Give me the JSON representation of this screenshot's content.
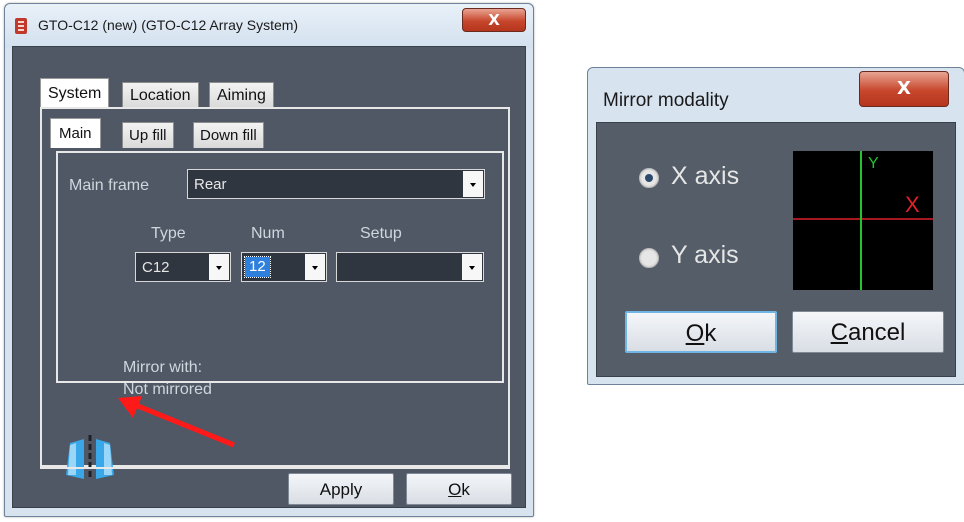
{
  "system_window": {
    "title": "GTO-C12 (new) (GTO-C12 Array System)",
    "close_glyph": "X",
    "tabs": [
      "System",
      "Location",
      "Aiming"
    ],
    "subtabs": [
      "Main",
      "Up fill",
      "Down fill"
    ],
    "main_frame": {
      "label": "Main frame",
      "value": "Rear"
    },
    "type": {
      "label": "Type",
      "value": "C12"
    },
    "num": {
      "label": "Num",
      "value": "12"
    },
    "setup": {
      "label": "Setup",
      "value": ""
    },
    "mirror": {
      "line1": "Mirror with:",
      "line2": "Not mirrored",
      "icon": "mirror-icon"
    },
    "apply_label": "Apply",
    "ok_label": "Ok",
    "ok_mnemonic": "O",
    "ok_rest": "k"
  },
  "mirror_dialog": {
    "title": "Mirror modality",
    "close_glyph": "X",
    "options": [
      "X axis",
      "Y axis"
    ],
    "selected": "X axis",
    "preview": {
      "y_label": "Y",
      "x_mark": "X"
    },
    "ok_mnemonic": "O",
    "ok_rest": "k",
    "cancel_mnemonic": "C",
    "cancel_rest": "ancel"
  },
  "annotation": {
    "arrow_color": "#ff0000"
  }
}
